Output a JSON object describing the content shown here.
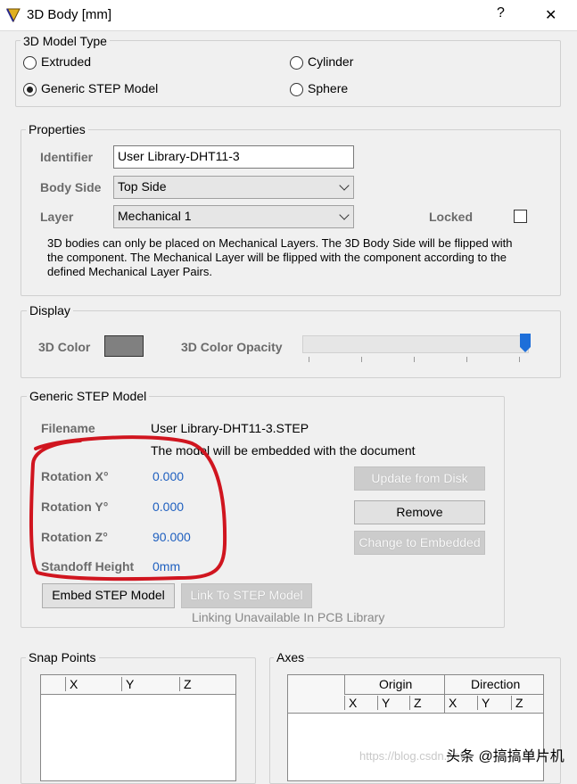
{
  "window": {
    "title": "3D Body [mm]",
    "help": "?",
    "close": "✕"
  },
  "model_type": {
    "legend": "3D Model Type",
    "options": [
      {
        "label": "Extruded",
        "selected": false
      },
      {
        "label": "Cylinder",
        "selected": false
      },
      {
        "label": "Generic STEP Model",
        "selected": true
      },
      {
        "label": "Sphere",
        "selected": false
      }
    ]
  },
  "properties": {
    "legend": "Properties",
    "identifier_label": "Identifier",
    "identifier_value": "User Library-DHT11-3",
    "body_side_label": "Body Side",
    "body_side_value": "Top Side",
    "layer_label": "Layer",
    "layer_value": "Mechanical 1",
    "locked_label": "Locked",
    "locked": false,
    "note_line1": "3D bodies can only be placed on Mechanical Layers. The 3D Body Side will be flipped with",
    "note_line2": "the component. The Mechanical Layer will be flipped with the component according to the",
    "note_line3": "defined Mechanical Layer Pairs."
  },
  "display": {
    "legend": "Display",
    "color_label": "3D Color",
    "color_value": "#808080",
    "opacity_label": "3D Color Opacity",
    "opacity_value": 1.0
  },
  "step_model": {
    "legend": "Generic STEP Model",
    "filename_label": "Filename",
    "filename_value": "User Library-DHT11-3.STEP",
    "embed_note": "The model will be embedded with the document",
    "rot_x_label": "Rotation X°",
    "rot_x_value": "0.000",
    "rot_y_label": "Rotation Y°",
    "rot_y_value": "0.000",
    "rot_z_label": "Rotation Z°",
    "rot_z_value": "90.000",
    "standoff_label": "Standoff Height",
    "standoff_value": "0mm",
    "update_btn": "Update from Disk",
    "remove_btn": "Remove",
    "change_btn": "Change to Embedded",
    "embed_btn": "Embed STEP Model",
    "link_btn": "Link To STEP Model",
    "link_note": "Linking Unavailable In PCB Library"
  },
  "snap_points": {
    "legend": "Snap Points",
    "cols": [
      "X",
      "Y",
      "Z"
    ]
  },
  "axes": {
    "legend": "Axes",
    "origin": "Origin",
    "direction": "Direction",
    "cols": [
      "X",
      "Y",
      "Z",
      "X",
      "Y",
      "Z"
    ]
  },
  "watermark": {
    "url": "https://blog.csdn.net",
    "caption": "头条 @搞搞单片机"
  },
  "annotation": {
    "color": "#d0151f"
  }
}
